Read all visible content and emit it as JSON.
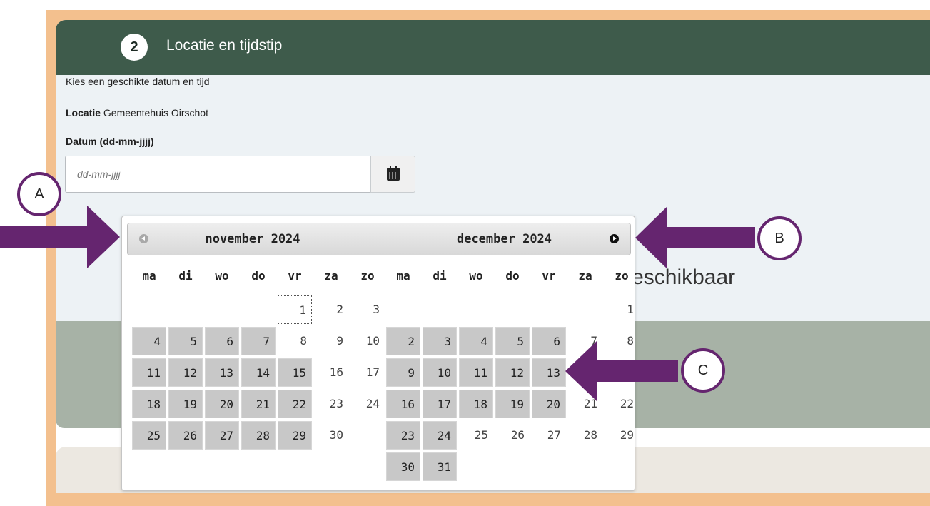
{
  "section": {
    "step_number": "2",
    "title": "Locatie en tijdstip"
  },
  "intro_text": "Kies een geschikte datum en tijd",
  "location": {
    "label": "Locatie",
    "value": "Gemeentehuis Oirschot"
  },
  "date_field": {
    "label": "Datum (dd-mm-jjjj)",
    "placeholder": "dd-mm-jjjj"
  },
  "availability_text_partial": "den beschikbaar",
  "datepicker": {
    "left_month": "november 2024",
    "right_month": "december 2024",
    "weekdays": [
      "ma",
      "di",
      "wo",
      "do",
      "vr",
      "za",
      "zo"
    ],
    "november": {
      "first_weekday_index": 4,
      "days": 30,
      "today": 1,
      "available": [
        4,
        5,
        6,
        7,
        11,
        12,
        13,
        14,
        15,
        18,
        19,
        20,
        21,
        22,
        25,
        26,
        27,
        28,
        29
      ]
    },
    "december": {
      "first_weekday_index": 6,
      "days": 31,
      "available": [
        2,
        3,
        4,
        5,
        6,
        9,
        10,
        11,
        12,
        13,
        16,
        17,
        18,
        19,
        20,
        23,
        24,
        30,
        31
      ]
    }
  },
  "annotations": {
    "a": "A",
    "b": "B",
    "c": "C",
    "arrow_color": "#65256f"
  },
  "colors": {
    "header_bg": "#3e5b4b",
    "frame": "#f3c08e",
    "available_day": "#c8c8c8"
  }
}
